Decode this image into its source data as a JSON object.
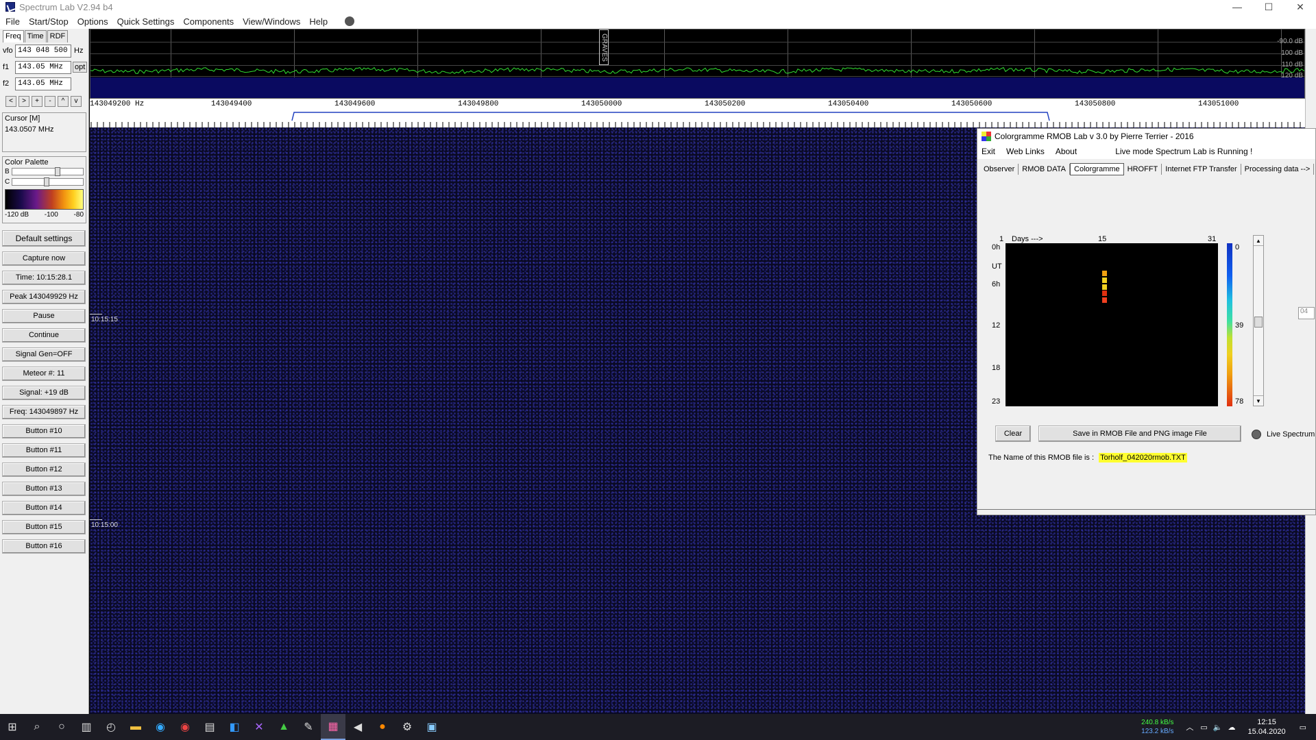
{
  "window": {
    "title": "Spectrum Lab V2.94 b4",
    "controls": [
      "—",
      "☐",
      "✕"
    ]
  },
  "menu": [
    "File",
    "Start/Stop",
    "Options",
    "Quick Settings",
    "Components",
    "View/Windows",
    "Help"
  ],
  "left_panel": {
    "tabs": [
      "Freq",
      "Time",
      "RDF"
    ],
    "vfo": {
      "label": "vfo",
      "value": "143 048 500",
      "unit": "Hz"
    },
    "f1": {
      "label": "f1",
      "value": "143.05 MHz",
      "opt": "opt"
    },
    "f2": {
      "label": "f2",
      "value": "143.05 MHz"
    },
    "arrows": [
      "<",
      ">",
      "+",
      "-",
      "^",
      "v"
    ],
    "cursor": {
      "title": "Cursor  [M]",
      "value": "143.0507 MHz"
    },
    "palette": {
      "title": "Color Palette",
      "b": "B",
      "c": "C",
      "scale": [
        "-120 dB",
        "-100",
        "-80"
      ]
    },
    "buttons": [
      "Default settings",
      "Capture now",
      "Time:  10:15:28.1",
      "Peak 143049929 Hz",
      "Pause",
      "Continue",
      "Signal Gen=OFF",
      "Meteor #: 11",
      "Signal: +19 dB",
      "Freq: 143049897 Hz",
      "Button #10",
      "Button #11",
      "Button #12",
      "Button #13",
      "Button #14",
      "Button #15",
      "Button #16"
    ]
  },
  "spectrum": {
    "db_labels": [
      "-90.0 dB",
      "100 dB",
      "110 dB",
      "120 dB"
    ],
    "marker": "GRAVES",
    "freq_labels": [
      "143049200 Hz",
      "143049400",
      "143049600",
      "143049800",
      "143050000",
      "143050200",
      "143050400",
      "143050600",
      "143050800",
      "143051000"
    ]
  },
  "waterfall": {
    "times": [
      "10:15:15",
      "10:15:00"
    ]
  },
  "rmob": {
    "title": "Colorgramme RMOB Lab v 3.0  by Pierre Terrier  -  2016",
    "menu": [
      "Exit",
      "Web Links",
      "About"
    ],
    "status": "Live mode Spectrum Lab is Running !",
    "tabs": [
      "Observer",
      "RMOB DATA",
      "Colorgramme",
      "HROFFT",
      "Internet FTP Transfer",
      "Processing data -->"
    ],
    "active_tab": "Colorgramme",
    "colorgramme": {
      "top_labels": [
        "1",
        "Days --->",
        "15",
        "31"
      ],
      "left_labels": [
        "0h",
        "UT",
        "6h",
        "12",
        "18",
        "23"
      ],
      "scale_labels": [
        "0",
        "39",
        "78"
      ],
      "marks": [
        {
          "day": 15,
          "hour": 4,
          "color": "#f0a010"
        },
        {
          "day": 15,
          "hour": 5,
          "color": "#f0d020"
        },
        {
          "day": 15,
          "hour": 6,
          "color": "#f0d020"
        },
        {
          "day": 15,
          "hour": 7,
          "color": "#e03010"
        },
        {
          "day": 15,
          "hour": 8,
          "color": "#f04020"
        }
      ]
    },
    "clear_button": "Clear",
    "save_button": "Save in RMOB File  and  PNG image File",
    "live_spectrum": "Live Spectrum",
    "file_label": "The Name of this RMOB file is :",
    "file_name": "Torholf_042020rmob.TXT",
    "side_value": "04"
  },
  "taskbar": {
    "net_up": "240.8 kB/s",
    "net_down": "123.2 kB/s",
    "time": "12:15",
    "date": "15.04.2020"
  }
}
